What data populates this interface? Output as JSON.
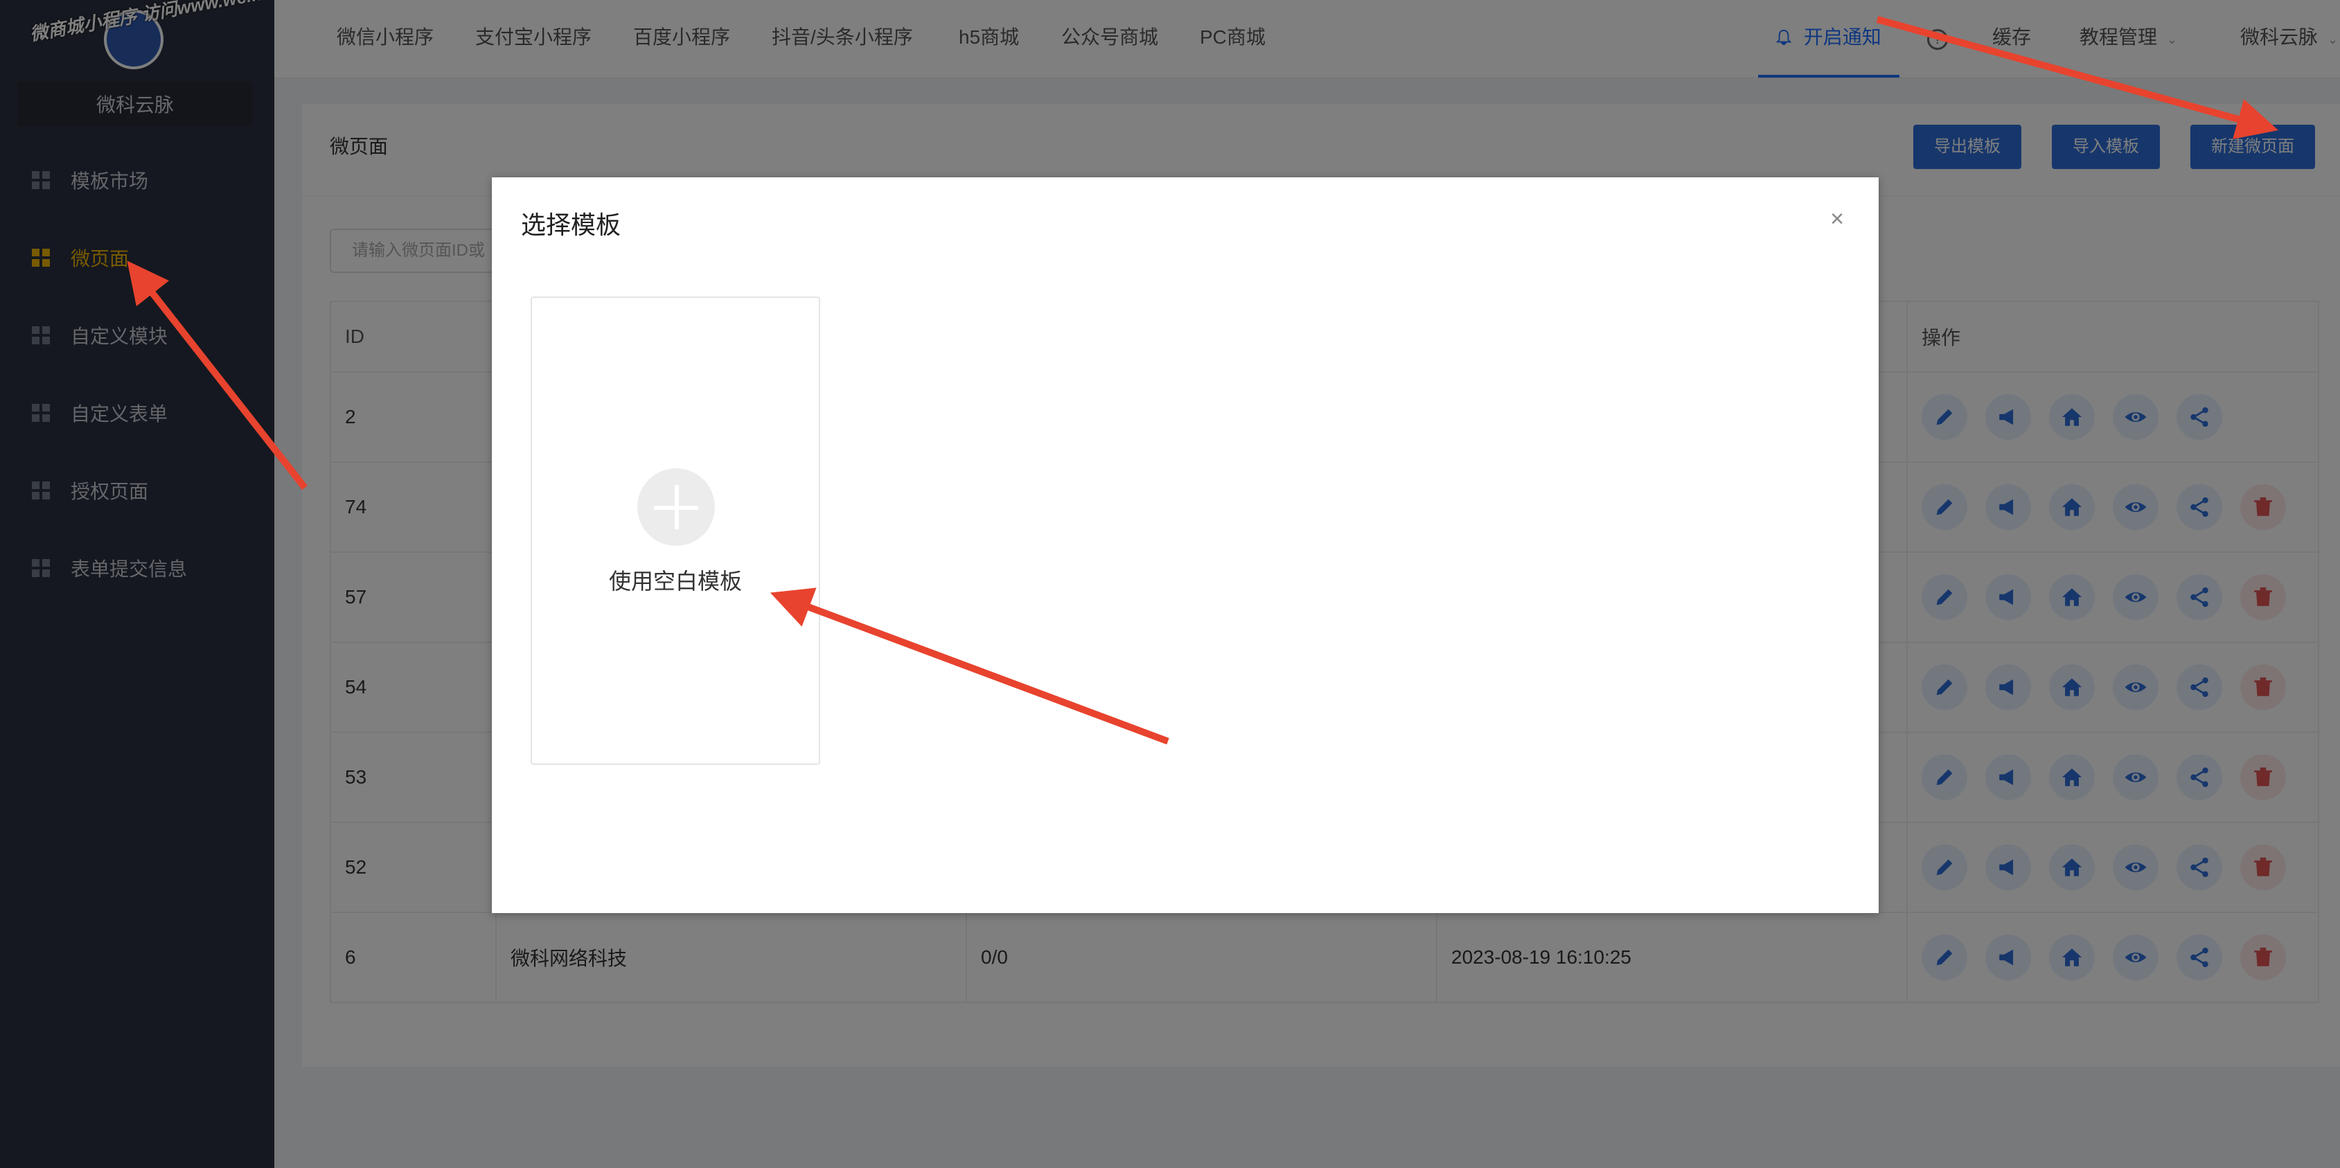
{
  "sidebar": {
    "watermark": "微商城小程序 访问www.weike.cc",
    "brand": "微科云脉",
    "items": [
      {
        "label": "模板市场",
        "active": false
      },
      {
        "label": "微页面",
        "active": true
      },
      {
        "label": "自定义模块",
        "active": false
      },
      {
        "label": "自定义表单",
        "active": false
      },
      {
        "label": "授权页面",
        "active": false
      },
      {
        "label": "表单提交信息",
        "active": false
      }
    ]
  },
  "topnav": {
    "items": [
      "微信小程序",
      "支付宝小程序",
      "百度小程序",
      "抖音/头条小程序",
      "h5商城",
      "公众号商城",
      "PC商城"
    ],
    "notify": "开启通知",
    "help": "?",
    "cache": "缓存",
    "tutorial": "教程管理",
    "user": "微科云脉"
  },
  "page": {
    "title": "微页面",
    "export_btn": "导出模板",
    "import_btn": "导入模板",
    "new_btn": "新建微页面",
    "search_placeholder": "请输入微页面ID或"
  },
  "table": {
    "headers": {
      "id": "ID",
      "name": "",
      "count": "",
      "time": "",
      "ops": "操作"
    },
    "rows": [
      {
        "id": "2",
        "name": "",
        "count": "",
        "time": ""
      },
      {
        "id": "74",
        "name": "",
        "count": "",
        "time": ""
      },
      {
        "id": "57",
        "name": "",
        "count": "",
        "time": ""
      },
      {
        "id": "54",
        "name": "",
        "count": "",
        "time": ""
      },
      {
        "id": "53",
        "name": "",
        "count": "",
        "time": ""
      },
      {
        "id": "52",
        "name": "",
        "count": "",
        "time": ""
      },
      {
        "id": "6",
        "name": "微科网络科技",
        "count": "0/0",
        "time": "2023-08-19 16:10:25"
      }
    ]
  },
  "modal": {
    "title": "选择模板",
    "blank_template": "使用空白模板",
    "close": "×"
  },
  "colors": {
    "accent": "#1e6fff",
    "active": "#f0b400",
    "arrow": "#e8432e",
    "danger": "#e05555"
  }
}
